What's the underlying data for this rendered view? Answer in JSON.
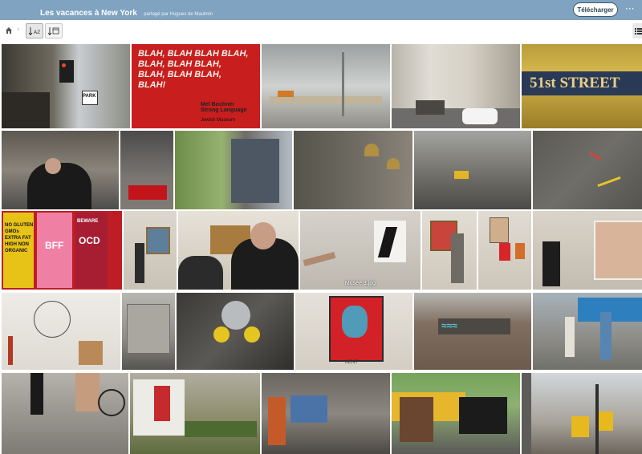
{
  "header": {
    "title": "Les vacances à New York",
    "shared_by": "partagé par Hugues de Maulmin",
    "download_label": "Télécharger",
    "more_icon": "more-horizontal-icon"
  },
  "toolbar": {
    "home_icon": "home-icon",
    "breadcrumb_separator": "›",
    "sort_alpha_label": "AZ",
    "sort_date_label": "date",
    "list_view_icon": "list-view-icon"
  },
  "photos": [
    {
      "id": "p1",
      "alt": "street corner with traffic light"
    },
    {
      "id": "p2",
      "alt": "red poster"
    },
    {
      "id": "p3",
      "alt": "glass staircase"
    },
    {
      "id": "p4",
      "alt": "street with buildings"
    },
    {
      "id": "p5",
      "alt": "51st street sign"
    },
    {
      "id": "p6",
      "alt": "man in black jacket"
    },
    {
      "id": "p7",
      "alt": "building with coca-cola truck"
    },
    {
      "id": "p8",
      "alt": "trees and glass tower"
    },
    {
      "id": "p9",
      "alt": "church domes"
    },
    {
      "id": "p10",
      "alt": "wet street"
    },
    {
      "id": "p11",
      "alt": "painted asphalt"
    },
    {
      "id": "p12",
      "alt": "candy bars"
    },
    {
      "id": "p13",
      "alt": "museum visitor"
    },
    {
      "id": "p14",
      "alt": "visitors looking at painting"
    },
    {
      "id": "p15",
      "alt": "Musée 3.jpg",
      "caption": "Musée 3.jpg"
    },
    {
      "id": "p16",
      "alt": "man at painting"
    },
    {
      "id": "p17",
      "alt": "couple in gallery"
    },
    {
      "id": "p18",
      "alt": "woman and painting"
    },
    {
      "id": "p19",
      "alt": "wire sculpture"
    },
    {
      "id": "p20",
      "alt": "building facade"
    },
    {
      "id": "p21",
      "alt": "fire hydrant connection"
    },
    {
      "id": "p22",
      "alt": "red portrait painting"
    },
    {
      "id": "p23",
      "alt": "graffiti wall"
    },
    {
      "id": "p24",
      "alt": "people on street"
    },
    {
      "id": "p25",
      "alt": "feet on pavement"
    },
    {
      "id": "p26",
      "alt": "delivery truck"
    },
    {
      "id": "p27",
      "alt": "shop front"
    },
    {
      "id": "p28",
      "alt": "horse carriage"
    },
    {
      "id": "p29",
      "alt": "traffic lights"
    }
  ],
  "photo_texts": {
    "blah": "BLAH, BLAH BLAH BLAH, BLAH, BLAH BLAH, BLAH, BLAH BLAH, BLAH!",
    "bochner": "Mel Bochner Strong Language",
    "jewish": "Jewish Museum",
    "street51": "51st STREET",
    "park": "PARK",
    "bff": "BFF",
    "ocd": "OCD",
    "gmos": "NO GLUTEN GMOs EXTRA FAT HIGH NON ORGANIC",
    "beware": "BEWARE",
    "kent": "KENT"
  }
}
